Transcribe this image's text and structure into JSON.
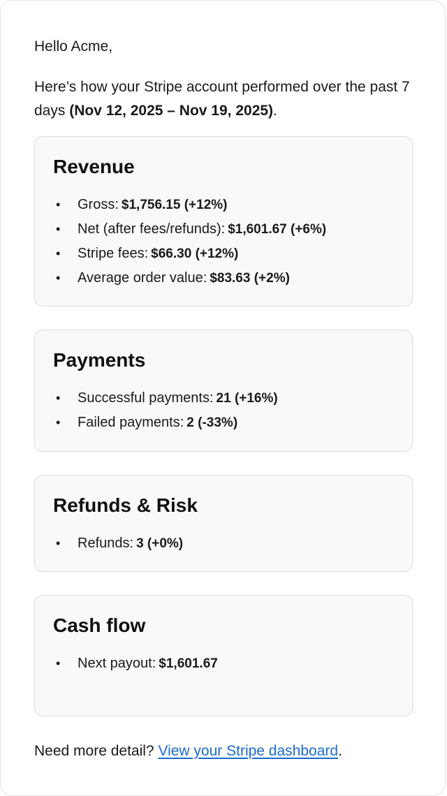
{
  "greeting": {
    "hello": "Hello",
    "name": "Acme,"
  },
  "intro": {
    "text": "Here’s how your Stripe account performed over the past 7 days",
    "range": "(Nov 12, 2025 – Nov 19, 2025)",
    "end": "."
  },
  "revenue": {
    "title": "Revenue",
    "items": [
      {
        "label": "Gross:",
        "value": "$1,756.15 (+12%)"
      },
      {
        "label": "Net (after fees/refunds):",
        "value": "$1,601.67 (+6%)"
      },
      {
        "label": "Stripe fees:",
        "value": "$66.30 (+12%)"
      },
      {
        "label": "Average order value:",
        "value": "$83.63 (+2%)"
      }
    ]
  },
  "payments": {
    "title": "Payments",
    "items": [
      {
        "label": "Successful payments:",
        "value": "21 (+16%)"
      },
      {
        "label": "Failed payments:",
        "value": "2 (-33%)"
      }
    ]
  },
  "refunds": {
    "title": "Refunds & Risk",
    "items": [
      {
        "label": "Refunds:",
        "value": "3 (+0%)"
      }
    ]
  },
  "cashflow": {
    "title": "Cash flow",
    "items": [
      {
        "label": "Next payout:",
        "value": "$1,601.67"
      }
    ]
  },
  "footer": {
    "question": "Need more detail?",
    "link_label": "View your Stripe dashboard",
    "end": "."
  },
  "bullet": "•",
  "colors": {
    "link": "#1a6bd1",
    "card_background": "#f9f9f9",
    "card_border": "#dddddd"
  }
}
